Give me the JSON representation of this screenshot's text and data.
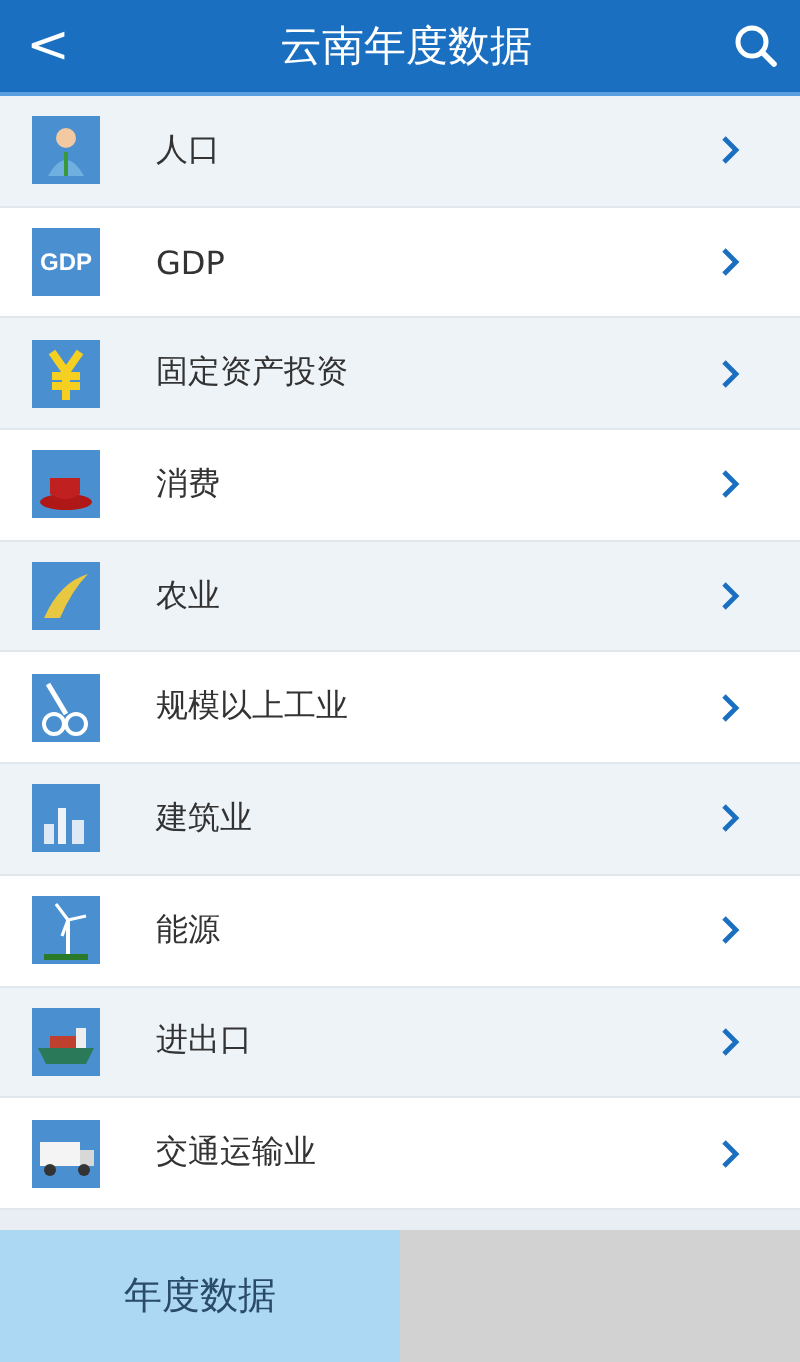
{
  "header": {
    "back": "<",
    "title": "云南年度数据"
  },
  "items": [
    {
      "label": "人口"
    },
    {
      "label": "GDP",
      "icon_text": "GDP"
    },
    {
      "label": "固定资产投资"
    },
    {
      "label": "消费"
    },
    {
      "label": "农业"
    },
    {
      "label": "规模以上工业"
    },
    {
      "label": "建筑业"
    },
    {
      "label": "能源"
    },
    {
      "label": "进出口"
    },
    {
      "label": "交通运输业"
    }
  ],
  "tabs": [
    {
      "label": "年度数据",
      "selected": true
    },
    {
      "selected": false
    }
  ]
}
